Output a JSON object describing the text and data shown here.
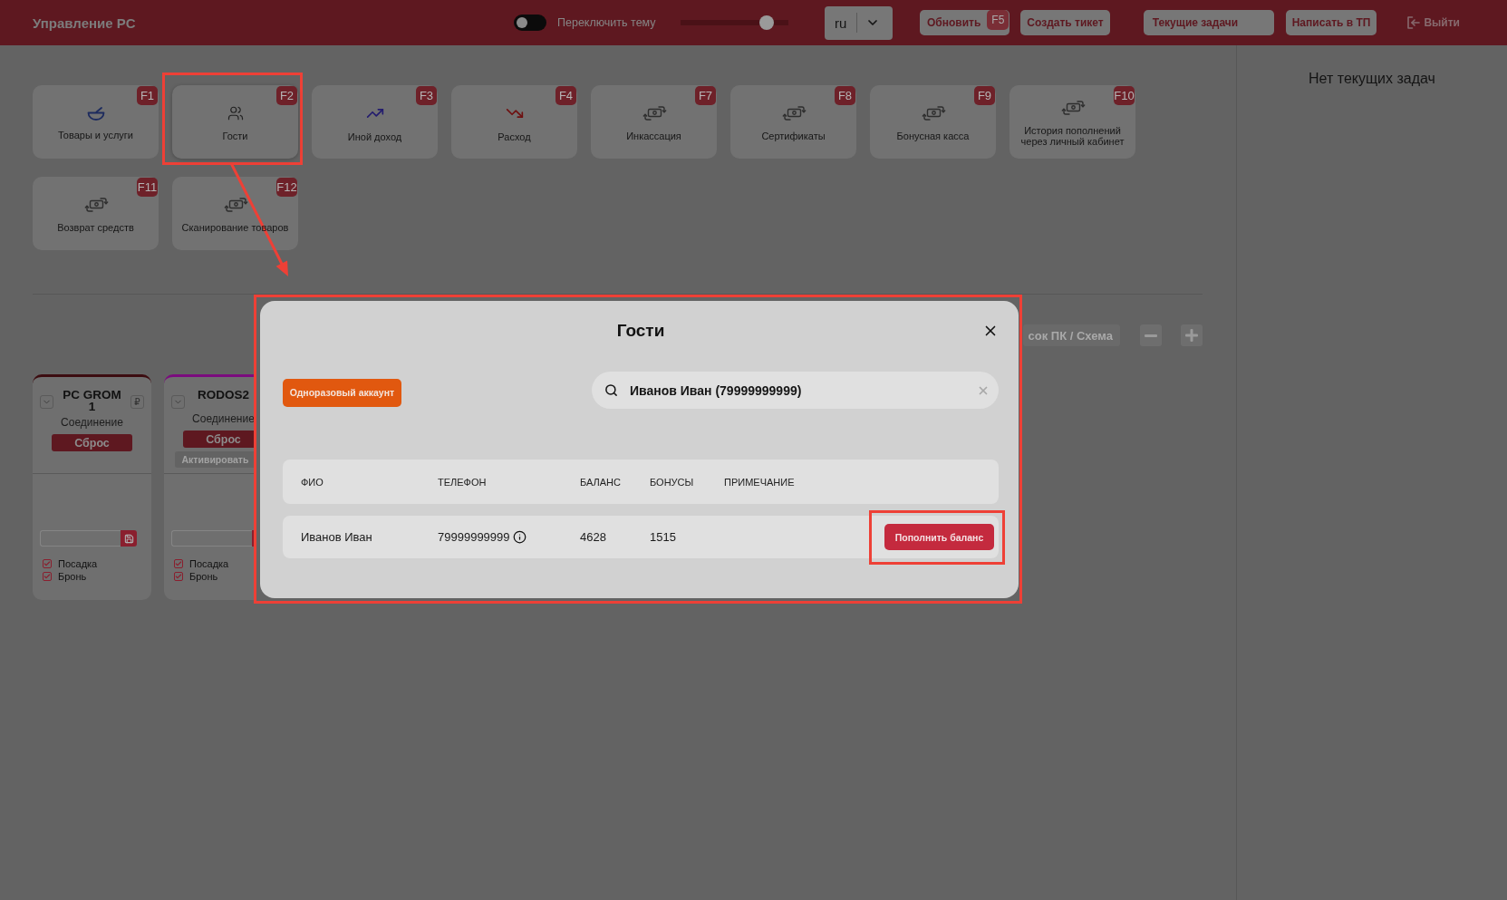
{
  "header": {
    "title": "Управление PC",
    "theme_toggle": {
      "label": "Переключить тему",
      "on": false
    },
    "scale_slider": {
      "level": 0.8
    },
    "language": {
      "value": "ru"
    },
    "actions": [
      {
        "label": "Обновить",
        "shortcut": "F5"
      },
      {
        "label": "Создать тикет"
      }
    ],
    "tasks_button": {
      "label": "Текущие задачи"
    },
    "support_button": {
      "label": "Написать в ТП"
    },
    "logout": {
      "label": "Выйти"
    }
  },
  "tiles": [
    {
      "kind": "goods",
      "label": "Товары и услуги",
      "shortcut": "F1",
      "highlighted": false
    },
    {
      "kind": "guests",
      "label": "Гости",
      "shortcut": "F2",
      "highlighted": true
    },
    {
      "kind": "income",
      "label": "Иной доход",
      "shortcut": "F3",
      "highlighted": false
    },
    {
      "kind": "expense",
      "label": "Расход",
      "shortcut": "F4",
      "highlighted": false
    },
    {
      "kind": "transfer",
      "label": "Инкассация",
      "shortcut": "F7",
      "highlighted": false
    },
    {
      "kind": "transfer",
      "label": "Сертификаты",
      "shortcut": "F8",
      "highlighted": false
    },
    {
      "kind": "transfer",
      "label": "Бонусная касса",
      "shortcut": "F9",
      "highlighted": false
    },
    {
      "kind": "transfer",
      "label": "История пополнений через личный кабинет",
      "shortcut": "F10",
      "highlighted": false
    },
    {
      "kind": "transfer",
      "label": "Возврат средств",
      "shortcut": "F11",
      "highlighted": false
    },
    {
      "kind": "transfer",
      "label": "Сканирование товаров",
      "shortcut": "F12",
      "highlighted": false
    }
  ],
  "pc_list": {
    "view_toggle": {
      "label": "сок ПК / Схема"
    },
    "cards": [
      {
        "name": "PC GROM 1",
        "status": "Соединение",
        "color": "#3c0c10",
        "ruble_button": {
          "label": "₽"
        },
        "reset": {
          "label": "Сброс"
        },
        "checkboxes": [
          {
            "label": "Посадка",
            "checked": true
          },
          {
            "label": "Бронь",
            "checked": true
          }
        ]
      },
      {
        "name": "RODOS2",
        "status": "Соединение",
        "color": "#7b0b7e",
        "reset": {
          "label": "Сброс"
        },
        "activate": {
          "label": "Активировать",
          "disabled": true
        },
        "checkboxes": [
          {
            "label": "Посадка",
            "checked": true
          },
          {
            "label": "Бронь",
            "checked": true
          }
        ]
      }
    ]
  },
  "tasks_panel": {
    "empty_text": "Нет текущих задач"
  },
  "guests_modal": {
    "title": "Гости",
    "highlighted": true,
    "one_time_button": {
      "label": "Одноразовый аккаунт"
    },
    "search": {
      "value": "Иванов Иван (79999999999)"
    },
    "table": {
      "columns": [
        "ФИО",
        "ТЕЛЕФОН",
        "БАЛАНС",
        "БОНУСЫ",
        "ПРИМЕЧАНИЕ"
      ],
      "rows": [
        {
          "name": "Иванов Иван",
          "phone": "79999999999",
          "balance": "4628",
          "bonuses": "1515",
          "action": {
            "label": "Пополнить баланс",
            "highlighted": true
          }
        }
      ]
    }
  },
  "annotation": {
    "arrow": true
  }
}
